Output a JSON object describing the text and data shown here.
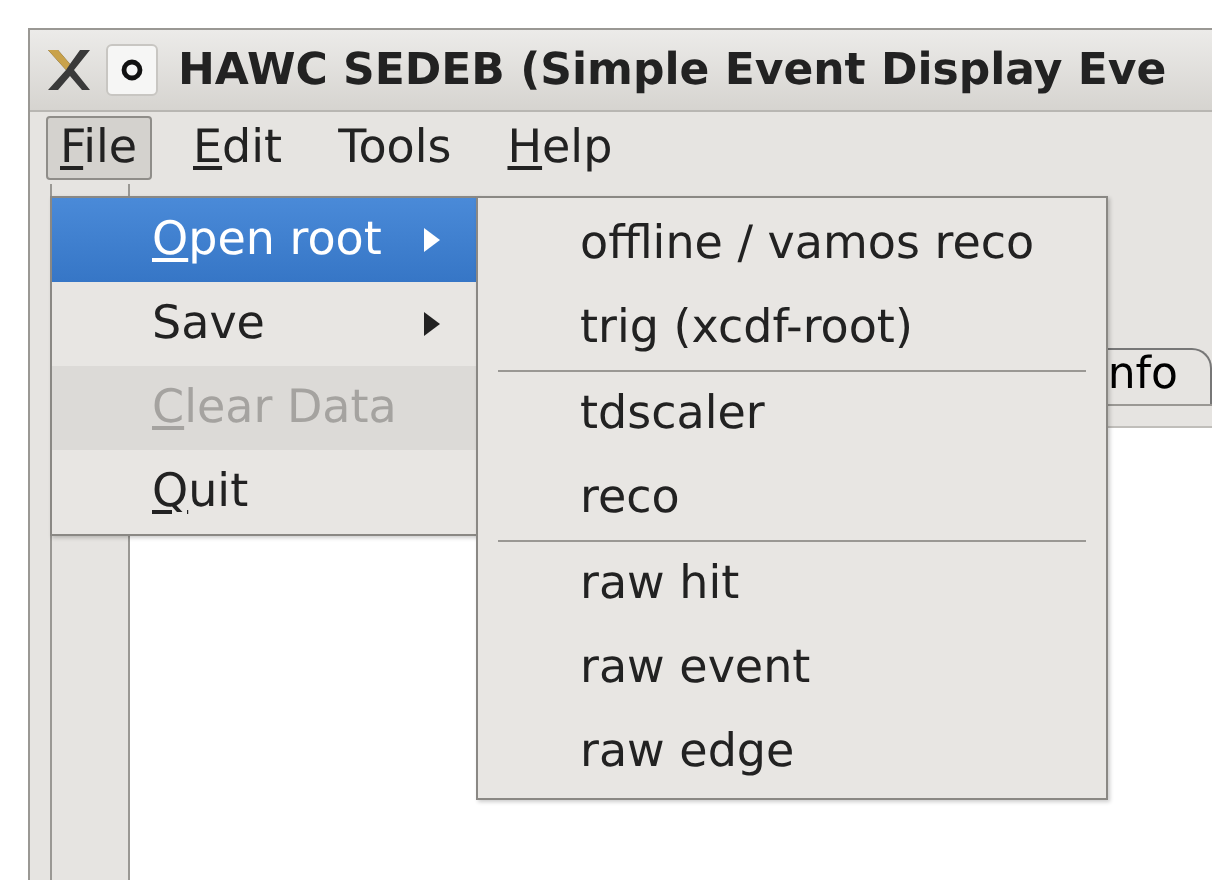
{
  "window": {
    "title": "HAWC SEDEB (Simple Event Display Eve"
  },
  "menubar": [
    {
      "label": "File",
      "underline_first": true,
      "selected": true
    },
    {
      "label": "Edit",
      "underline_first": true,
      "selected": false
    },
    {
      "label": "Tools",
      "underline_first": false,
      "selected": false
    },
    {
      "label": "Help",
      "underline_first": true,
      "selected": false
    }
  ],
  "file_menu": [
    {
      "label": "Open root",
      "underline_first": true,
      "submenu": true,
      "selected": true,
      "disabled": false
    },
    {
      "label": "Save",
      "underline_first": false,
      "submenu": true,
      "selected": false,
      "disabled": false
    },
    {
      "label": "Clear Data",
      "underline_first": true,
      "submenu": false,
      "selected": false,
      "disabled": true
    },
    {
      "label": "Quit",
      "underline_first": true,
      "submenu": false,
      "selected": false,
      "disabled": false
    }
  ],
  "open_root_submenu": [
    {
      "kind": "item",
      "label": "offline / vamos reco"
    },
    {
      "kind": "item",
      "label": "trig (xcdf-root)"
    },
    {
      "kind": "separator"
    },
    {
      "kind": "item",
      "label": "tdscaler"
    },
    {
      "kind": "item",
      "label": "reco"
    },
    {
      "kind": "separator"
    },
    {
      "kind": "item",
      "label": "raw hit"
    },
    {
      "kind": "item",
      "label": "raw event"
    },
    {
      "kind": "item",
      "label": "raw edge"
    }
  ],
  "tabs": [
    {
      "label": "nfo"
    }
  ]
}
